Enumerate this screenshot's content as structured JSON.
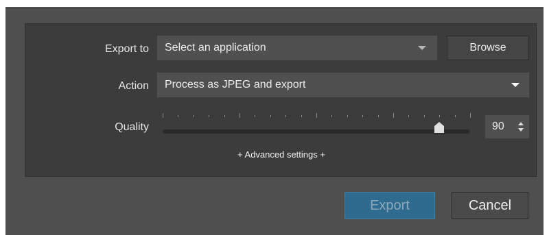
{
  "form": {
    "export_to_label": "Export to",
    "export_to_value": "Select an application",
    "browse_label": "Browse",
    "action_label": "Action",
    "action_value": "Process as JPEG and export",
    "quality_label": "Quality",
    "quality_value": "90",
    "advanced_label": "+ Advanced settings +"
  },
  "slider": {
    "min": 0,
    "max": 100,
    "value": 90
  },
  "footer": {
    "export_label": "Export",
    "cancel_label": "Cancel"
  },
  "colors": {
    "accent": "#2f6b8e",
    "panel": "#3c3c3c",
    "dialog": "#4f4f4f"
  }
}
